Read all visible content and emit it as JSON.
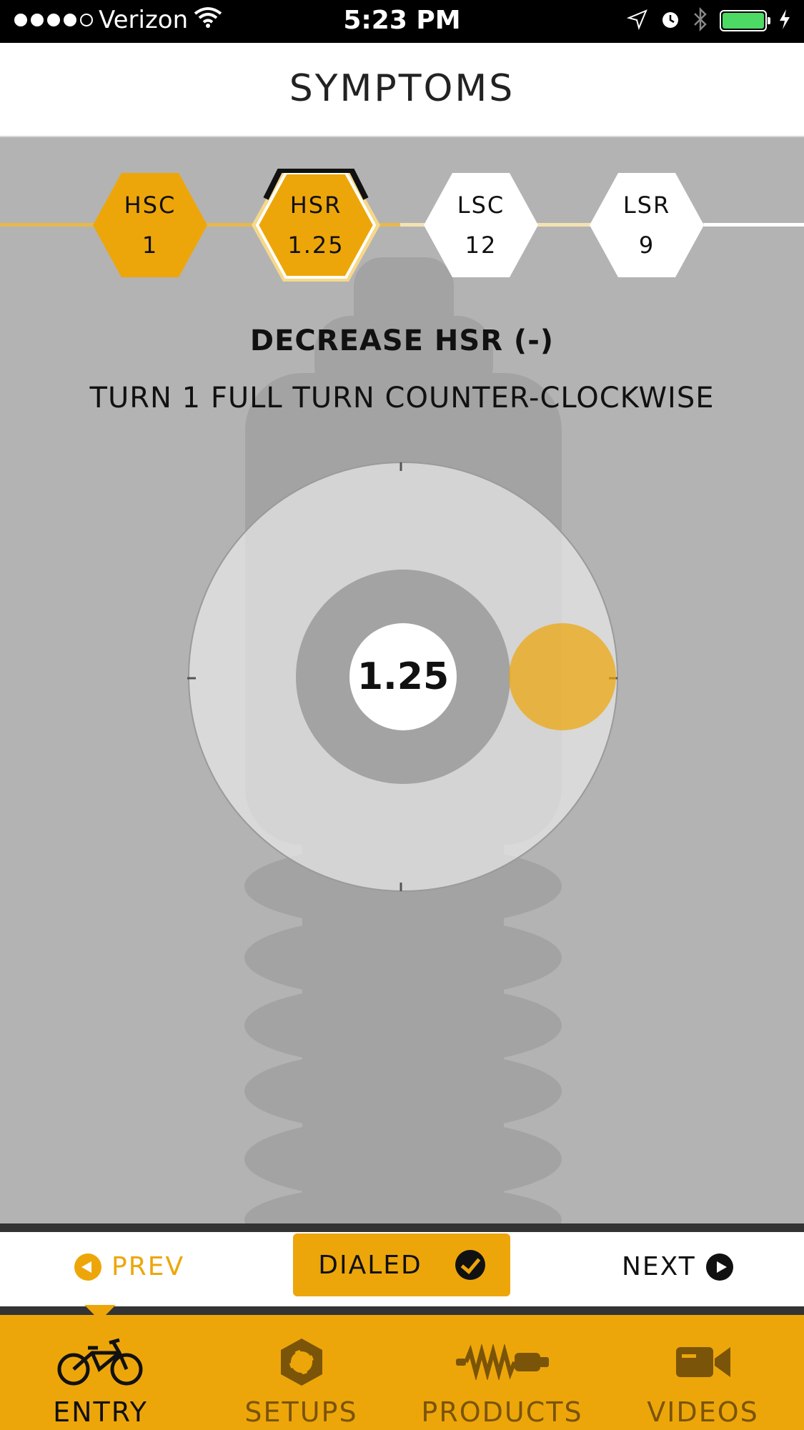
{
  "status_bar": {
    "carrier": "Verizon",
    "time": "5:23 PM",
    "signal_filled": 4,
    "icons": [
      "wifi-icon",
      "location-icon",
      "alarm-icon",
      "bluetooth-icon",
      "battery-icon",
      "charging-icon"
    ],
    "battery_level": 1.0
  },
  "header": {
    "title": "SYMPTOMS"
  },
  "adjusters": [
    {
      "label": "HSC",
      "value": "1",
      "state": "completed"
    },
    {
      "label": "HSR",
      "value": "1.25",
      "state": "active"
    },
    {
      "label": "LSC",
      "value": "12",
      "state": "pending"
    },
    {
      "label": "LSR",
      "value": "9",
      "state": "pending"
    }
  ],
  "instruction": {
    "title": "DECREASE HSR (-)",
    "text": "TURN 1 FULL TURN COUNTER-CLOCKWISE"
  },
  "dial": {
    "value": "1.25",
    "icon": "shock-silhouette-icon"
  },
  "actions": {
    "prev_label": "PREV",
    "dialed_label": "DIALED",
    "next_label": "NEXT"
  },
  "tabs": [
    {
      "label": "ENTRY",
      "icon": "bike-icon",
      "active": true
    },
    {
      "label": "SETUPS",
      "icon": "hex-nut-icon",
      "active": false
    },
    {
      "label": "PRODUCTS",
      "icon": "shock-icon",
      "active": false
    },
    {
      "label": "VIDEOS",
      "icon": "video-camera-icon",
      "active": false
    }
  ],
  "colors": {
    "accent": "#eda60a",
    "background": "#b3b3b3",
    "dark": "#111111",
    "white": "#ffffff"
  }
}
